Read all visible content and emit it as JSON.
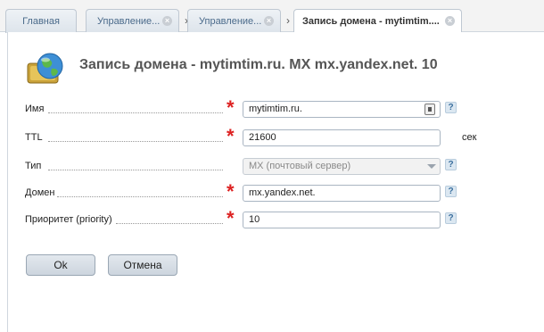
{
  "tabs": [
    {
      "label": "Главная",
      "closable": false,
      "active": false
    },
    {
      "label": "Управление...",
      "closable": true,
      "active": false
    },
    {
      "label": "Управление...",
      "closable": true,
      "active": false
    },
    {
      "label": "Запись домена - mytimtim....",
      "closable": true,
      "active": true
    }
  ],
  "page": {
    "title": "Запись домена - mytimtim.ru. MX mx.yandex.net. 10",
    "icon": "globe-icon"
  },
  "form": {
    "name": {
      "label": "Имя",
      "value": "mytimtim.ru.",
      "required": true
    },
    "ttl": {
      "label": "TTL",
      "value": "21600",
      "unit": "сек",
      "required": true
    },
    "type": {
      "label": "Тип",
      "value": "MX (почтовый сервер)",
      "disabled": true,
      "required": false
    },
    "domain": {
      "label": "Домен",
      "value": "mx.yandex.net.",
      "required": true
    },
    "priority": {
      "label": "Приоритет (priority)",
      "value": "10",
      "required": true
    },
    "required_mark": "*",
    "help_mark": "?"
  },
  "buttons": {
    "ok": "Ok",
    "cancel": "Отмена"
  },
  "colors": {
    "required": "#dd2222",
    "title": "#555555",
    "help_bg": "#dbe7f1"
  }
}
